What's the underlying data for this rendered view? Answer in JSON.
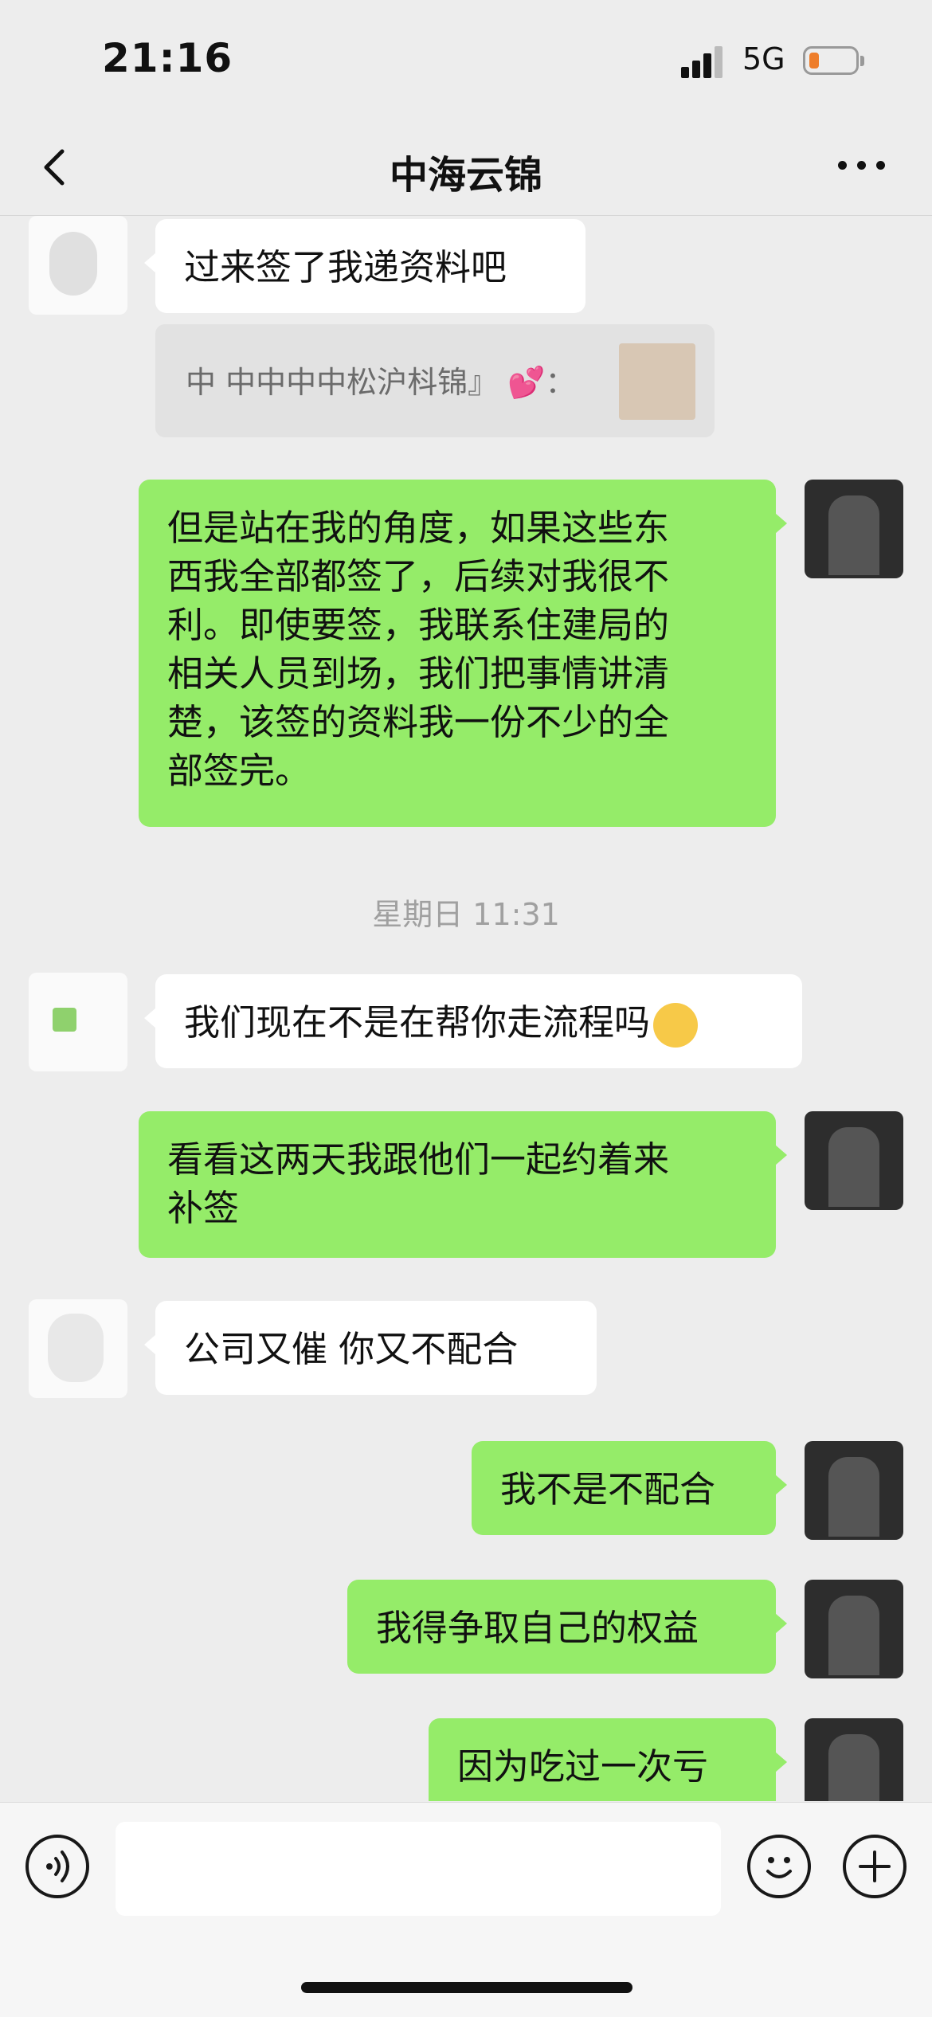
{
  "status_bar": {
    "time": "21:16",
    "network": "5G",
    "battery_color": "#ee7d2a"
  },
  "nav": {
    "title": "中海云锦",
    "back_icon": "chevron-left-icon",
    "more_icon": "more-dots-icon"
  },
  "colors": {
    "self_bubble": "#95ec69",
    "peer_bubble": "#ffffff",
    "background": "#ededed"
  },
  "messages": [
    {
      "from": "peer",
      "text": "过来签了我递资料吧"
    },
    {
      "from": "quote",
      "text": "中 中中中中松沪枓锦』 💕："
    },
    {
      "from": "self",
      "lines": [
        "但是站在我的角度，如果这些东",
        "西我全部都签了，后续对我很不",
        "利。即使要签，我联系住建局的",
        "相关人员到场，我们把事情讲清",
        "楚，该签的资料我一份不少的全",
        "部签完。"
      ]
    },
    {
      "from": "time",
      "text": "星期日 11:31"
    },
    {
      "from": "peer",
      "text": "我们现在不是在帮你走流程吗"
    },
    {
      "from": "self",
      "lines": [
        "看看这两天我跟他们一起约着来",
        "补签"
      ]
    },
    {
      "from": "peer",
      "text": "公司又催 你又不配合"
    },
    {
      "from": "self",
      "text": "我不是不配合"
    },
    {
      "from": "self",
      "text": "我得争取自己的权益"
    },
    {
      "from": "self",
      "text": "因为吃过一次亏"
    }
  ],
  "input_bar": {
    "placeholder": "",
    "voice_icon": "voice-icon",
    "emoji_icon": "emoji-icon",
    "plus_icon": "plus-icon"
  }
}
